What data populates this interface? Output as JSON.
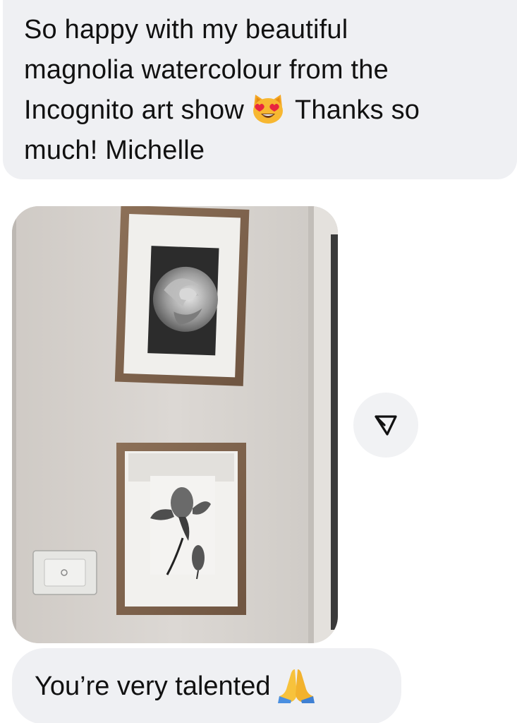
{
  "messages": {
    "incoming_text": {
      "line1": "So happy with my beautiful",
      "line2": "magnolia watercolour from the",
      "line3a": "Incognito art show",
      "emoji1": "smiling-cat-heart-eyes-emoji",
      "line3b": "Thanks so",
      "line4": "much! Michelle"
    },
    "photo": {
      "description_icon": "photo-attachment"
    },
    "reply": {
      "text": "You’re very talented",
      "emoji": "folded-hands-emoji"
    }
  },
  "actions": {
    "share_icon": "share-arrow-icon"
  },
  "colors": {
    "bubble_bg": "#eff0f3",
    "page_bg": "#ffffff",
    "text": "#111111"
  }
}
